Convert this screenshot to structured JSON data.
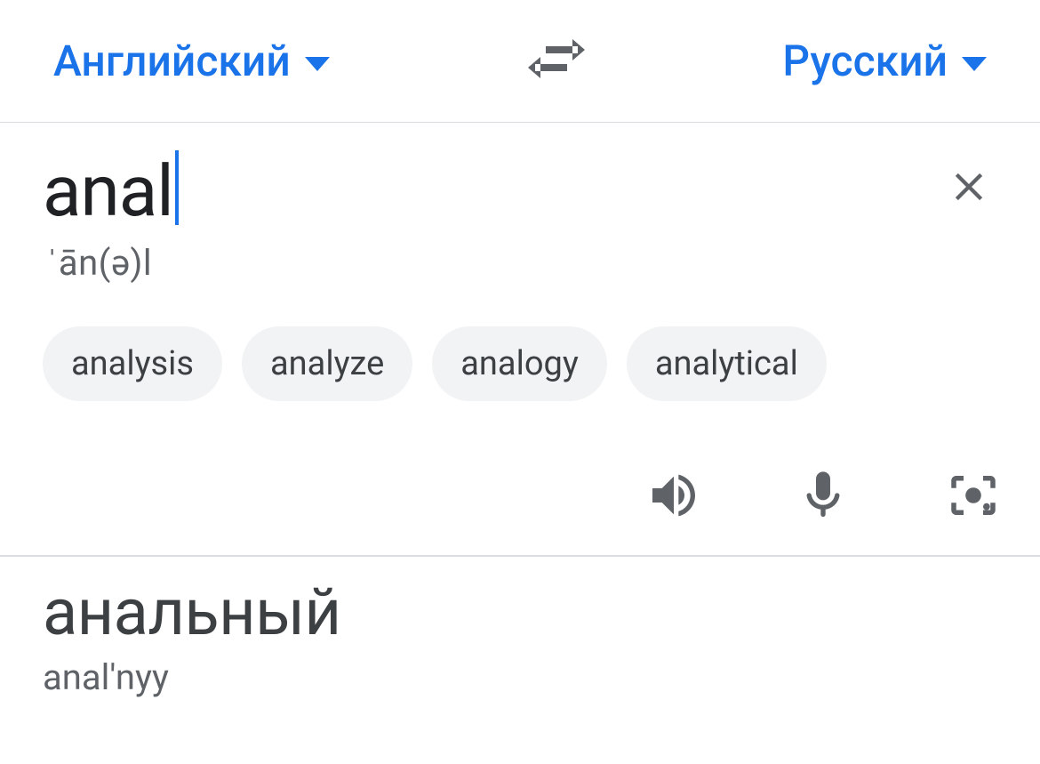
{
  "header": {
    "source_language": "Английский",
    "target_language": "Русский"
  },
  "input": {
    "text": "anal",
    "pronunciation": "ˈān(ə)l",
    "suggestions": [
      "analysis",
      "analyze",
      "analogy",
      "analytical"
    ]
  },
  "output": {
    "translation": "анальный",
    "transliteration": "anal'nyy"
  }
}
